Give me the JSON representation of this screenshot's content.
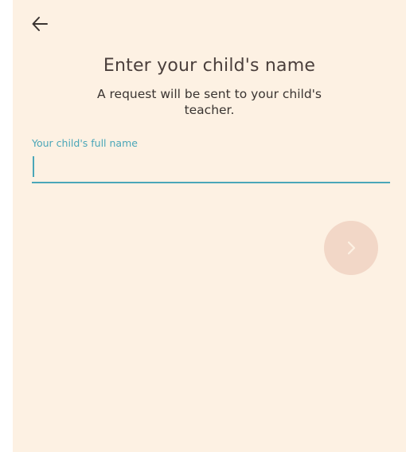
{
  "header": {
    "back_icon": "arrow-left-icon"
  },
  "main": {
    "title": "Enter your child's name",
    "subtitle": "A request will be sent to your child's teacher."
  },
  "form": {
    "name_label": "Your child's full name",
    "name_value": "",
    "name_placeholder": ""
  },
  "actions": {
    "next_icon": "chevron-right-icon",
    "next_enabled": false
  },
  "colors": {
    "background": "#fdf1e3",
    "accent": "#4aa6b8",
    "next_button_disabled": "#f2d7c7",
    "title_text": "#4a3f3c"
  }
}
